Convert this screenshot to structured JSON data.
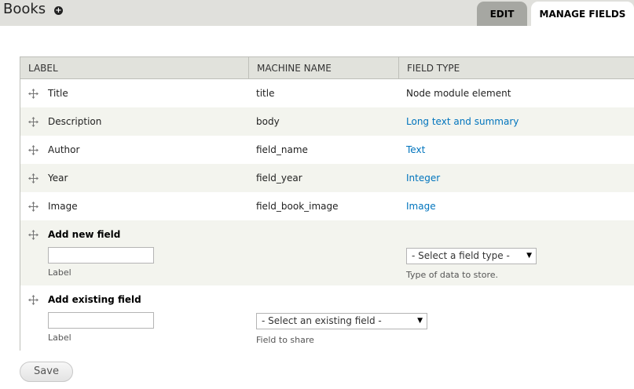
{
  "header": {
    "title": "Books",
    "add_icon": "plus-circle-icon",
    "tabs": [
      {
        "label": "EDIT",
        "active": false
      },
      {
        "label": "MANAGE FIELDS",
        "active": true
      }
    ]
  },
  "table": {
    "columns": [
      "LABEL",
      "MACHINE NAME",
      "FIELD TYPE"
    ],
    "rows": [
      {
        "label": "Title",
        "machine_name": "title",
        "field_type": "Node module element",
        "is_link": false
      },
      {
        "label": "Description",
        "machine_name": "body",
        "field_type": "Long text and summary",
        "is_link": true
      },
      {
        "label": "Author",
        "machine_name": "field_name",
        "field_type": "Text",
        "is_link": true
      },
      {
        "label": "Year",
        "machine_name": "field_year",
        "field_type": "Integer",
        "is_link": true
      },
      {
        "label": "Image",
        "machine_name": "field_book_image",
        "field_type": "Image",
        "is_link": true
      }
    ],
    "add_new": {
      "heading": "Add new field",
      "label_value": "",
      "label_caption": "Label",
      "type_select": "- Select a field type -",
      "type_caption": "Type of data to store."
    },
    "add_existing": {
      "heading": "Add existing field",
      "label_value": "",
      "label_caption": "Label",
      "field_select": "- Select an existing field -",
      "field_caption": "Field to share"
    }
  },
  "actions": {
    "save_label": "Save"
  },
  "colors": {
    "header_bg": "#e0e0dc",
    "link": "#0074bd",
    "row_alt": "#f3f4ee"
  }
}
